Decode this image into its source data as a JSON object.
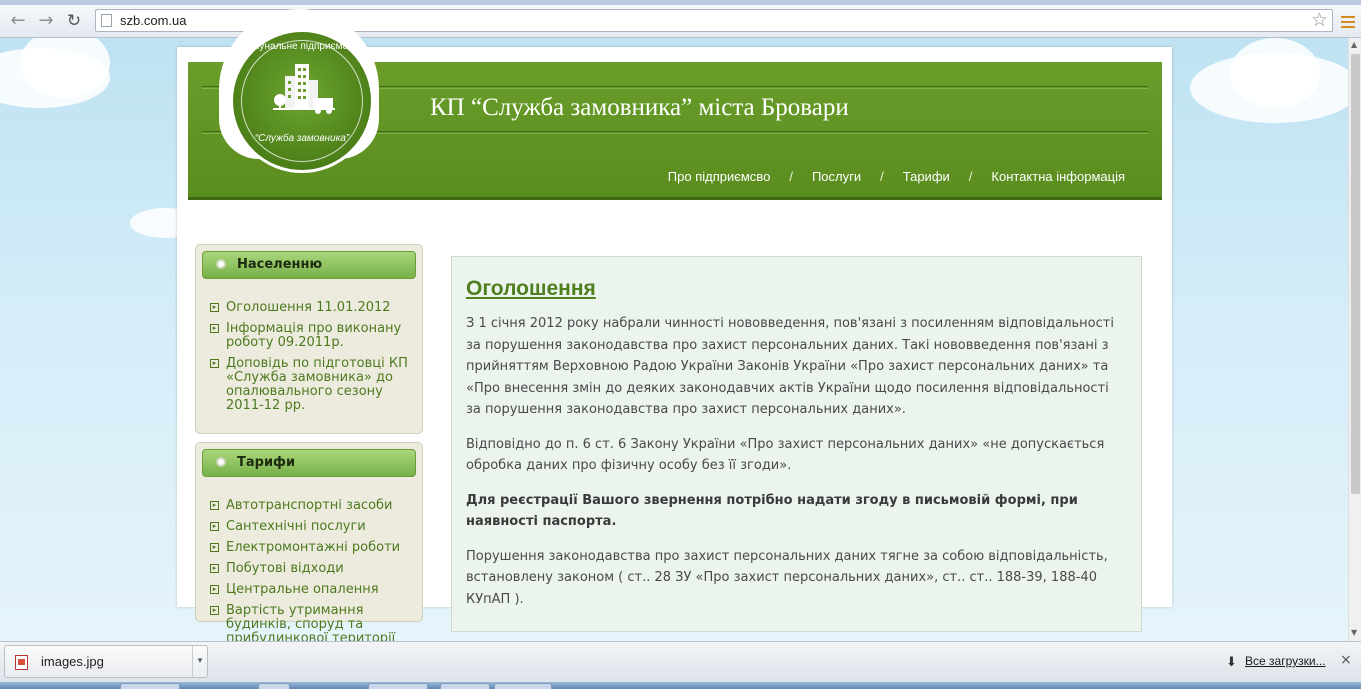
{
  "browser": {
    "url": "szb.com.ua",
    "icons": {
      "back": "back-arrow-icon",
      "forward": "forward-arrow-icon",
      "reload": "reload-icon",
      "bookmark": "star-icon",
      "menu": "menu-icon"
    }
  },
  "site": {
    "title": "КП “Служба замовника”  міста Бровари",
    "logo": {
      "text_top": "Комунальне підприємство",
      "text_bottom": "“Служба замовника”"
    },
    "nav": [
      "Про підприємсво",
      "Послуги",
      "Тарифи",
      "Контактна інформація"
    ],
    "nav_separator": "/"
  },
  "sidebar": {
    "boxes": [
      {
        "title": "Населенню",
        "items": [
          "Оголошення 11.01.2012",
          "Інформація про виконану роботу 09.2011р.",
          "Доповідь по підготовці КП «Служба замовника» до опалювального сезону 2011-12 рр."
        ]
      },
      {
        "title": "Тарифи",
        "items": [
          "Автотранспортні засоби",
          "Сантехнічні послуги",
          "Електромонтажні роботи",
          "Побутові відходи",
          "Центральне опалення",
          "Вартість утримання будинків, споруд та прибудинкової території"
        ]
      }
    ]
  },
  "content": {
    "title": "Оголошення",
    "paragraphs": [
      "З 1 січня 2012 року набрали чинності нововведення, пов'язані з посиленням відповідальності за порушення законодавства про захист персональних даних. Такі нововведення пов'язані з прийняттям Верховною Радою України Законів України «Про захист персональних даних» та «Про внесення змін до деяких законодавчих актів України щодо посилення відповідальності за порушення законодавства про захист персональних даних».",
      "Відповідно до п. 6 ст. 6 Закону України «Про захист персональних даних» «не допускається обробка даних про фізичну особу без її згоди».",
      "Для реєстрації Вашого звернення потрібно надати згоду в письмовій формі, при наявності паспорта.",
      "Порушення законодавства про захист персональних даних тягне за собою відповідальність, встановлену законом ( ст.. 28 ЗУ «Про захист персональних даних», ст.. ст.. 188-39, 188-40 КУпАП )."
    ]
  },
  "downloads": {
    "file_name": "images.jpg",
    "all_label": "Все загрузки...",
    "close_glyph": "×"
  },
  "colors": {
    "header_green": "#5a8d1f",
    "link_green": "#4d7a1f",
    "content_bg": "#ebf4ed",
    "sidebar_bg": "#ecebde"
  }
}
